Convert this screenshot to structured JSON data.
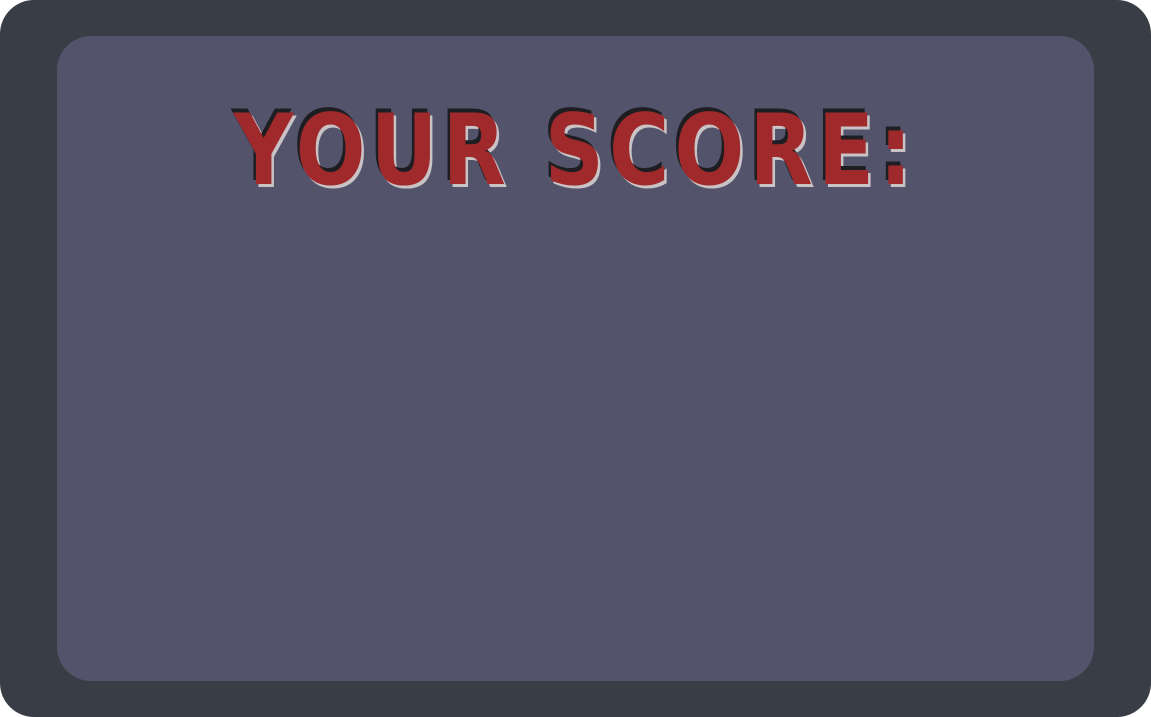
{
  "screen": {
    "title": "YOUR SCORE:"
  },
  "colors": {
    "outer_frame": "#383d46",
    "panel": "#53546b",
    "title_fill": "#a0292b",
    "title_shadow_dark": "#1e1e22",
    "title_highlight": "#c9c3c6"
  }
}
